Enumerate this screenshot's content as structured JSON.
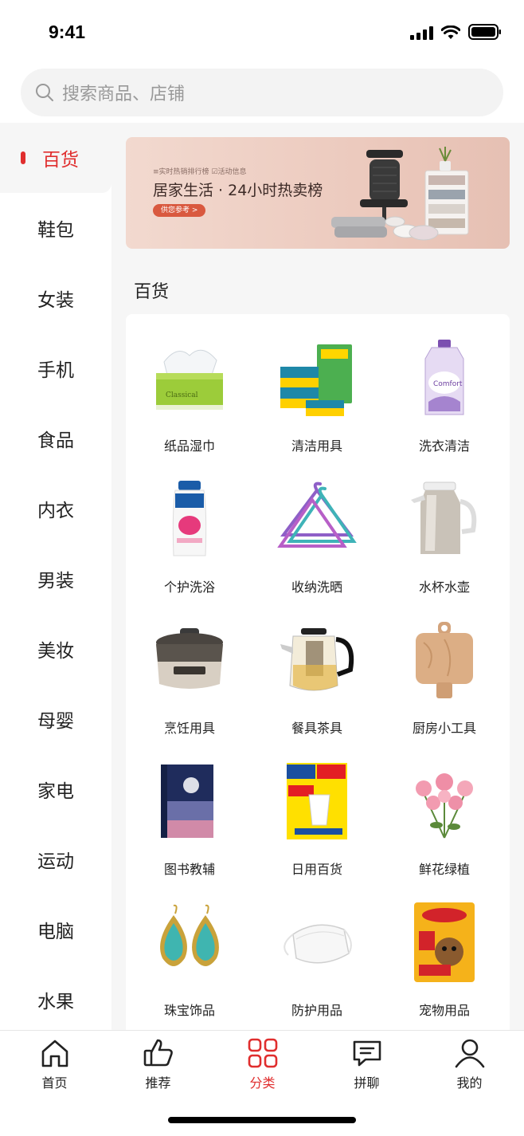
{
  "status": {
    "time": "9:41"
  },
  "search": {
    "placeholder": "搜索商品、店铺"
  },
  "sidebar": {
    "items": [
      {
        "label": "百货",
        "active": true
      },
      {
        "label": "鞋包"
      },
      {
        "label": "女装"
      },
      {
        "label": "手机"
      },
      {
        "label": "食品"
      },
      {
        "label": "内衣"
      },
      {
        "label": "男装"
      },
      {
        "label": "美妆"
      },
      {
        "label": "母婴"
      },
      {
        "label": "家电"
      },
      {
        "label": "运动"
      },
      {
        "label": "电脑"
      },
      {
        "label": "水果"
      }
    ]
  },
  "banner": {
    "subtitle": "≡实时热销排行榜   ☑活动信息",
    "title": "居家生活 · 24小时热卖榜",
    "button": "供您参考 >"
  },
  "section": {
    "title": "百货"
  },
  "categories": [
    {
      "label": "纸品湿巾",
      "icon": "tissue-box-icon"
    },
    {
      "label": "清洁用具",
      "icon": "sponge-icon"
    },
    {
      "label": "洗衣清洁",
      "icon": "detergent-icon"
    },
    {
      "label": "个护洗浴",
      "icon": "shampoo-icon"
    },
    {
      "label": "收纳洗晒",
      "icon": "hanger-icon"
    },
    {
      "label": "水杯水壶",
      "icon": "kettle-icon"
    },
    {
      "label": "烹饪用具",
      "icon": "cooker-icon"
    },
    {
      "label": "餐具茶具",
      "icon": "teapot-icon"
    },
    {
      "label": "厨房小工具",
      "icon": "cutting-board-icon"
    },
    {
      "label": "图书教辅",
      "icon": "book-icon"
    },
    {
      "label": "日用百货",
      "icon": "paper-cups-icon"
    },
    {
      "label": "鲜花绿植",
      "icon": "flowers-icon"
    },
    {
      "label": "珠宝饰品",
      "icon": "earrings-icon"
    },
    {
      "label": "防护用品",
      "icon": "mask-icon"
    },
    {
      "label": "宠物用品",
      "icon": "pet-food-icon"
    }
  ],
  "tabbar": {
    "tabs": [
      {
        "label": "首页",
        "icon": "home-icon"
      },
      {
        "label": "推荐",
        "icon": "thumbs-up-icon"
      },
      {
        "label": "分类",
        "icon": "category-grid-icon",
        "active": true
      },
      {
        "label": "拼聊",
        "icon": "chat-icon"
      },
      {
        "label": "我的",
        "icon": "profile-icon"
      }
    ]
  },
  "colors": {
    "accent": "#e02e2e"
  }
}
